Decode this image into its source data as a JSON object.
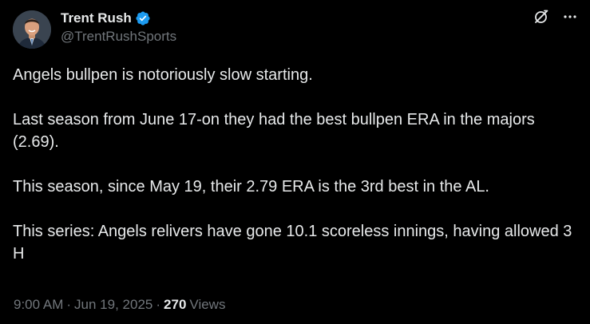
{
  "author": {
    "display_name": "Trent Rush",
    "handle": "@TrentRushSports",
    "verified": true,
    "verified_color": "#1d9bf0"
  },
  "tweet": {
    "paragraphs": [
      "Angels bullpen is notoriously slow starting.",
      "Last season from June 17-on they had the best bullpen ERA in the majors (2.69).",
      "This season, since May 19, their 2.79 ERA is the 3rd best in the AL.",
      "This series: Angels relivers have gone 10.1 scoreless innings, having allowed 3 H"
    ]
  },
  "meta": {
    "time": "9:00 AM",
    "date": "Jun 19, 2025",
    "separator": "·",
    "views_count": "270",
    "views_label": "Views"
  },
  "icons": {
    "grok": "grok-icon",
    "more": "more-icon",
    "verified": "verified-badge-icon"
  }
}
